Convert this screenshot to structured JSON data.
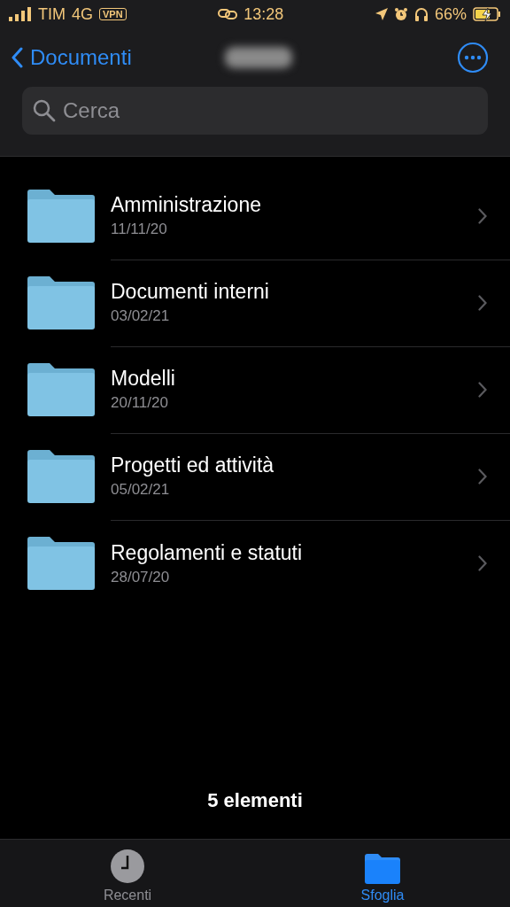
{
  "status_bar": {
    "carrier": "TIM",
    "network": "4G",
    "vpn": "VPN",
    "time": "13:28",
    "battery": "66%"
  },
  "nav": {
    "back": "Documenti"
  },
  "search": {
    "placeholder": "Cerca"
  },
  "folders": [
    {
      "name": "Amministrazione",
      "date": "11/11/20"
    },
    {
      "name": "Documenti interni",
      "date": "03/02/21"
    },
    {
      "name": "Modelli",
      "date": "20/11/20"
    },
    {
      "name": "Progetti ed attività",
      "date": "05/02/21"
    },
    {
      "name": "Regolamenti e statuti",
      "date": "28/07/20"
    }
  ],
  "count": "5 elementi",
  "tabs": [
    {
      "label": "Recenti",
      "kind": "recent",
      "selected": false
    },
    {
      "label": "Sfoglia",
      "kind": "browse",
      "selected": true
    }
  ]
}
